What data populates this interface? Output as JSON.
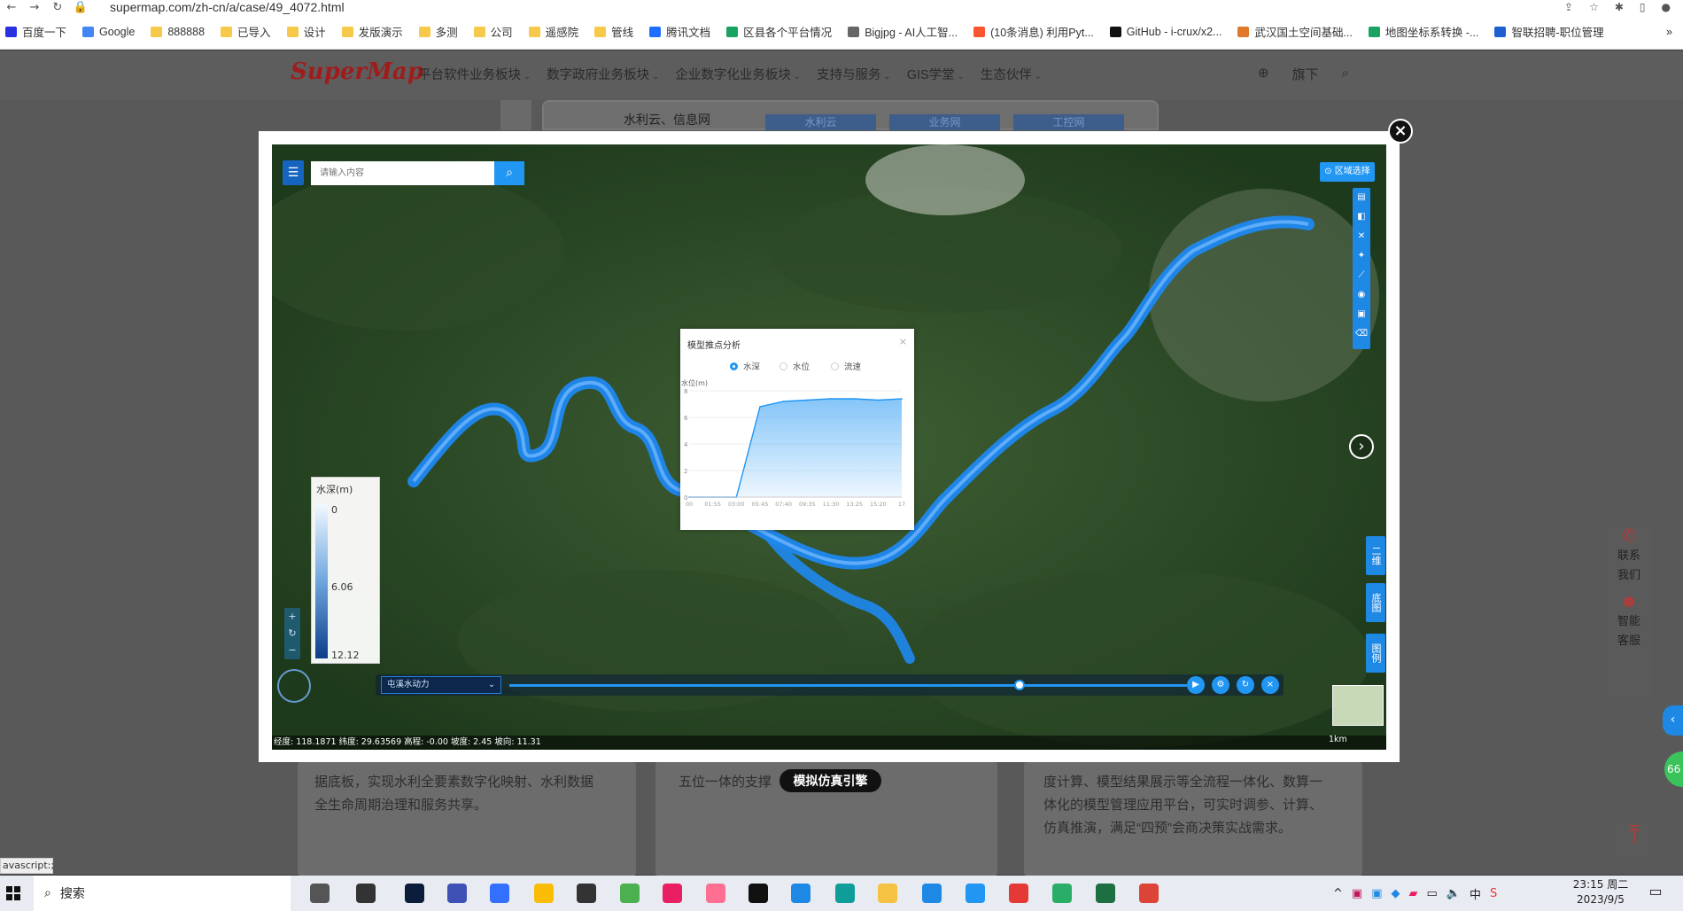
{
  "browser": {
    "url": "supermap.com/zh-cn/a/case/49_4072.html",
    "bookmarks": [
      {
        "label": "百度一下",
        "icon": "baidu-icon",
        "color": "#2932e1"
      },
      {
        "label": "Google",
        "icon": "google-icon",
        "color": "#4285f4"
      },
      {
        "label": "888888",
        "icon": "folder-icon",
        "color": "#f6c94a"
      },
      {
        "label": "已导入",
        "icon": "folder-icon",
        "color": "#f6c94a"
      },
      {
        "label": "设计",
        "icon": "folder-icon",
        "color": "#f6c94a"
      },
      {
        "label": "发版演示",
        "icon": "folder-icon",
        "color": "#f6c94a"
      },
      {
        "label": "多测",
        "icon": "folder-icon",
        "color": "#f6c94a"
      },
      {
        "label": "公司",
        "icon": "folder-icon",
        "color": "#f6c94a"
      },
      {
        "label": "遥感院",
        "icon": "folder-icon",
        "color": "#f6c94a"
      },
      {
        "label": "管线",
        "icon": "folder-icon",
        "color": "#f6c94a"
      },
      {
        "label": "腾讯文档",
        "icon": "tencent-docs-icon",
        "color": "#1e6fff"
      },
      {
        "label": "区县各个平台情况",
        "icon": "sheet-icon",
        "color": "#1aa260"
      },
      {
        "label": "Bigjpg - AI人工智...",
        "icon": "bigjpg-icon",
        "color": "#666666"
      },
      {
        "label": "(10条消息) 利用Pyt...",
        "icon": "csdn-icon",
        "color": "#fc5531"
      },
      {
        "label": "GitHub - i-crux/x2...",
        "icon": "github-icon",
        "color": "#111111"
      },
      {
        "label": "武汉国土空间基础...",
        "icon": "site-icon",
        "color": "#e07a2a"
      },
      {
        "label": "地图坐标系转换 -...",
        "icon": "site-icon",
        "color": "#1aa260"
      },
      {
        "label": "智联招聘-职位管理",
        "icon": "zhaopin-icon",
        "color": "#1e5fd1"
      }
    ],
    "more": "»"
  },
  "site": {
    "logo": "SuperMap",
    "nav": [
      "平台软件业务板块",
      "数字政府业务板块",
      "企业数字化业务板块",
      "支持与服务",
      "GIS学堂",
      "生态伙伴"
    ],
    "lang_label": "旗下",
    "strip_text": "水利云、信息网",
    "strip_tabs": [
      "水利云",
      "业务网",
      "工控网"
    ],
    "bg_col1": [
      "据底板，实现水利全要素数字化映射、水利数据",
      "全生命周期治理和服务共享。"
    ],
    "bg_col2": [
      "五位一体的支撑"
    ],
    "bg_col3": [
      "度计算、模型结果展示等全流程一体化、数算一",
      "体化的模型管理应用平台，可实时调参、计算、",
      "仿真推演，满足“四预”会商决策实战需求。"
    ],
    "tip_button": "模拟仿真引擎",
    "contact": [
      "联系",
      "我们"
    ],
    "robot": [
      "智能",
      "客服"
    ],
    "side_badge": "66",
    "status_text": "avascript:;"
  },
  "map": {
    "search_placeholder": "请输入内容",
    "region_button": "⊙ 区域选择",
    "right_buttons": [
      "二维",
      "底图",
      "图例"
    ],
    "legend": {
      "title": "水深(m)",
      "values": [
        "0",
        "6.06",
        "12.12"
      ]
    },
    "timeline_select": "屯溪水动力",
    "coords": "经度: 118.1871  纬度: 29.63569  高程: -0.00  坡度: 2.45  坡向: 11.31",
    "scale": "1km"
  },
  "chart_data": {
    "type": "area",
    "title": "模型推点分析",
    "options": [
      "水深",
      "水位",
      "流速"
    ],
    "selected": "水深",
    "ylabel": "水位(m)",
    "ylim": [
      0,
      8
    ],
    "yticks": [
      0,
      2,
      4,
      6,
      8
    ],
    "x": [
      "00",
      "01:55",
      "03:00",
      "05:45",
      "07:40",
      "09:35",
      "11:30",
      "13:25",
      "15:20",
      "17"
    ],
    "values": [
      0,
      0,
      0,
      6.8,
      7.2,
      7.3,
      7.4,
      7.4,
      7.3,
      7.4
    ],
    "color": "#2196f3"
  },
  "taskbar": {
    "search_placeholder": "搜索",
    "time": "23:15 周二",
    "date": "2023/9/5",
    "ime": "中"
  }
}
